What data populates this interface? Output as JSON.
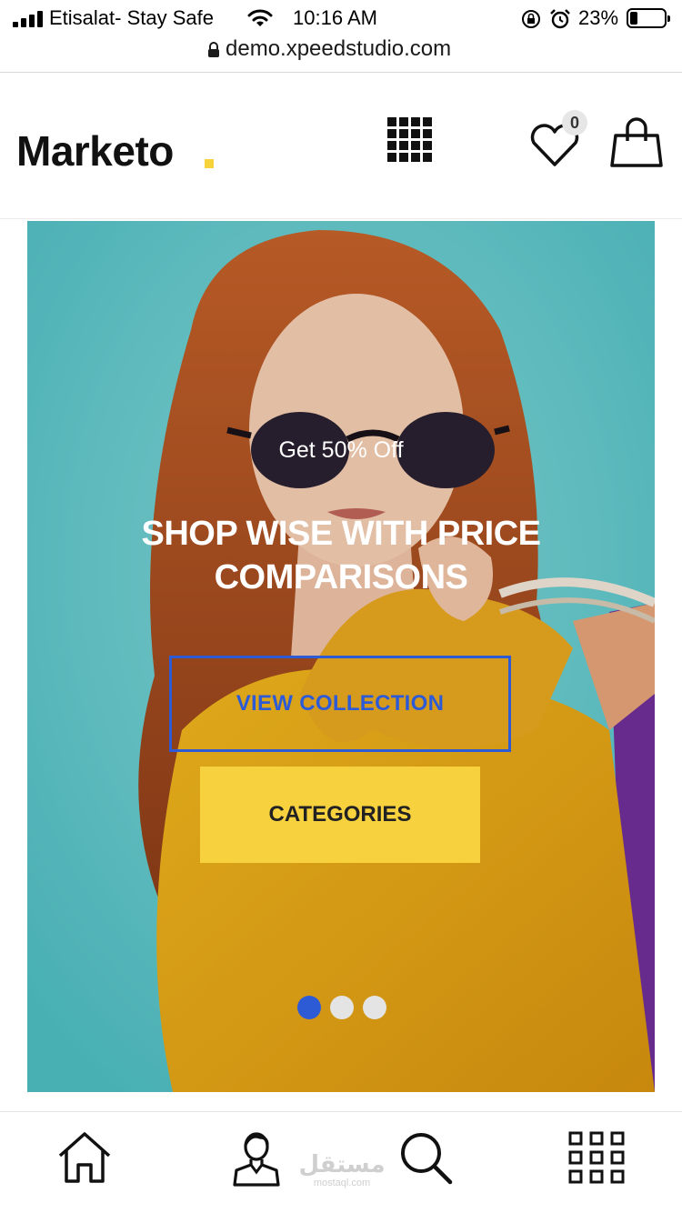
{
  "status_bar": {
    "carrier": "Etisalat- Stay Safe",
    "time": "10:16 AM",
    "battery_percent": "23%",
    "battery_level": 0.23,
    "icons": [
      "signal-icon",
      "wifi-icon",
      "orientation-lock-icon",
      "alarm-icon",
      "battery-icon"
    ]
  },
  "browser": {
    "url": "demo.xpeedstudio.com",
    "icon": "lock-icon"
  },
  "header": {
    "logo": "Marketo",
    "logo_dot_color": "#f6d33b",
    "wishlist_count": "0",
    "icons": [
      "grid-menu-icon",
      "heart-icon",
      "shopping-bag-icon"
    ]
  },
  "hero": {
    "subtitle": "Get 50% Off",
    "title": "SHOP WISE WITH PRICE COMPARISONS",
    "primary_button": "VIEW COLLECTION",
    "secondary_button": "CATEGORIES",
    "slide_count": 3,
    "active_slide": 1,
    "colors": {
      "accent_blue": "#2d5bd6",
      "accent_yellow": "#f7d23e",
      "background_teal": "#6ecfd2"
    }
  },
  "bottom_nav": {
    "items": [
      "home-icon",
      "account-icon",
      "search-icon",
      "apps-grid-icon"
    ],
    "watermark_arabic": "مستقل",
    "watermark_latin": "mostaql.com"
  }
}
